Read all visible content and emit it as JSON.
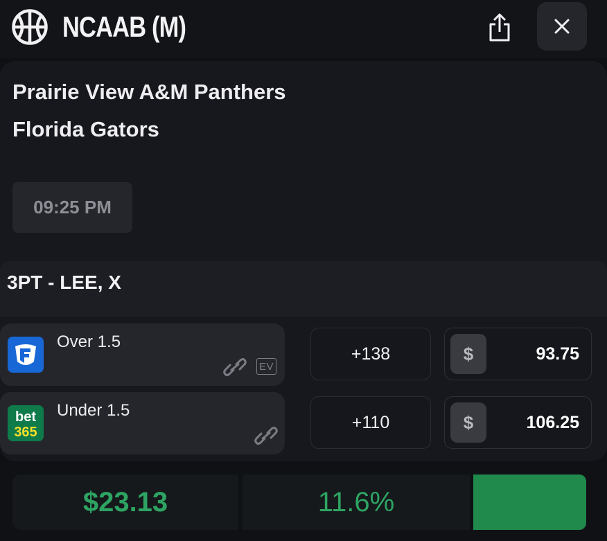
{
  "header": {
    "league": "NCAAB (M)",
    "icons": {
      "sport": "basketball-icon",
      "share": "share-icon",
      "close": "close-icon"
    }
  },
  "event": {
    "teams": [
      "Prairie View A&M Panthers",
      "Florida Gators"
    ],
    "time": "09:25 PM"
  },
  "market": {
    "title": "3PT - LEE, X",
    "bets": [
      {
        "book_logo": "fanduel-logo",
        "label": "Over 1.5",
        "odds": "+138",
        "currency": "$",
        "stake": "93.75",
        "ev_badge": "EV"
      },
      {
        "book_logo": "bet365-logo",
        "label": "Under 1.5",
        "odds": "+110",
        "currency": "$",
        "stake": "106.25",
        "bet365_logo_text": [
          "bet",
          "365"
        ]
      }
    ]
  },
  "summary": {
    "profit": "$23.13",
    "percent": "11.6%"
  },
  "colors": {
    "accent_green": "#2ea463",
    "button_green": "#1f8a4c",
    "fanduel_blue": "#1867d6",
    "bet365_green": "#0f7a4a",
    "bet365_yellow": "#f7e02a"
  }
}
